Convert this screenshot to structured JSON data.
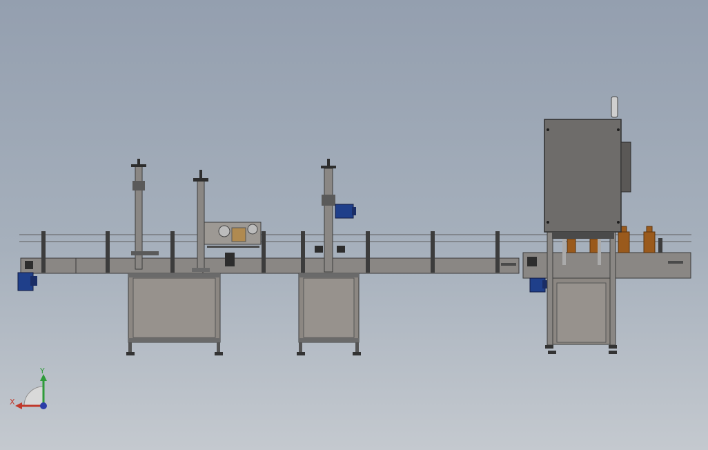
{
  "viewport": {
    "background_top": "#949faf",
    "background_bottom": "#c4c9cf"
  },
  "model": {
    "frame_color": "#6a6a6a",
    "cabinet_color": "#8c8782",
    "motor_color": "#1f3f8a",
    "bottle_color": "#9a5a1c"
  },
  "triad": {
    "x_label": "X",
    "y_label": "Y",
    "x_color": "#c0392b",
    "y_color": "#2e9b3a",
    "z_color": "#2b3ea8",
    "icon": "coordinate-triad-icon"
  }
}
